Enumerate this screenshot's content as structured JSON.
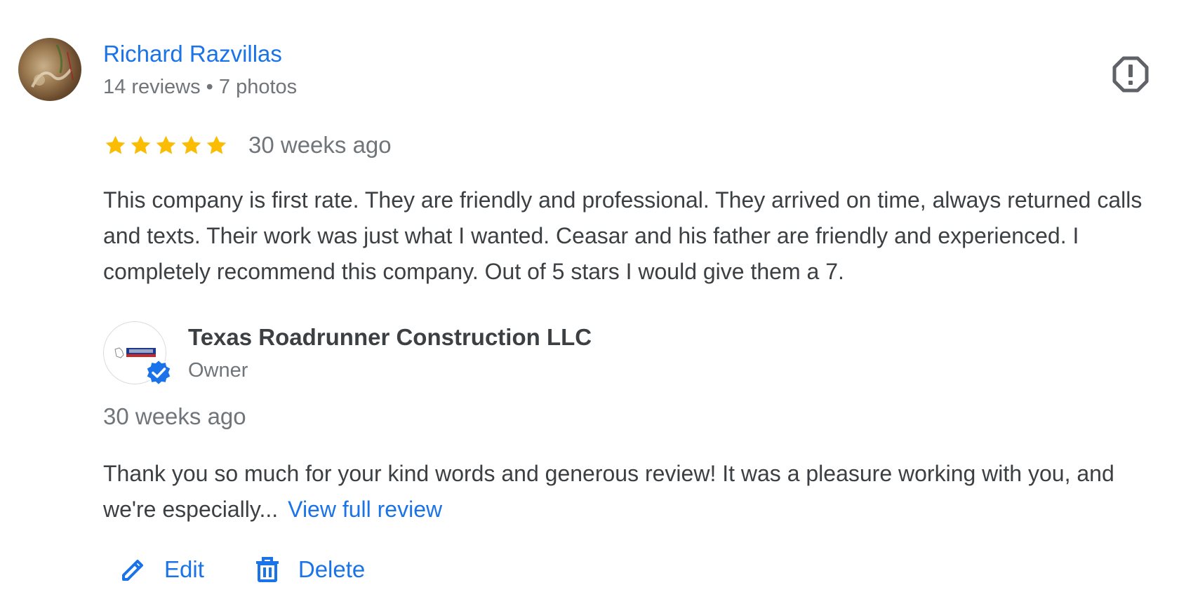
{
  "review": {
    "reviewer_name": "Richard Razvillas",
    "reviewer_meta": "14 reviews • 7 photos",
    "rating": 5,
    "rating_max": 5,
    "date": "30 weeks ago",
    "text": "This company is first rate. They are friendly and professional. They arrived on time, always returned calls and texts. Their work was just what I wanted. Ceasar and his father are friendly and experienced. I completely recommend this company. Out of 5 stars I would give them a 7."
  },
  "owner_response": {
    "business_name": "Texas Roadrunner Construction LLC",
    "role": "Owner",
    "date": "30 weeks ago",
    "text": "Thank you so much for your kind words and generous review! It was a pleasure working with you, and we're especially...",
    "view_full_label": "View full review"
  },
  "actions": {
    "edit_label": "Edit",
    "delete_label": "Delete"
  },
  "icons": {
    "report": "report-icon",
    "star": "star-icon",
    "verified": "verified-badge-icon",
    "edit": "pencil-icon",
    "delete": "trash-icon"
  },
  "colors": {
    "link": "#1a73e8",
    "star": "#fbbc04",
    "secondary_text": "#70757a",
    "primary_text": "#3c4043"
  }
}
